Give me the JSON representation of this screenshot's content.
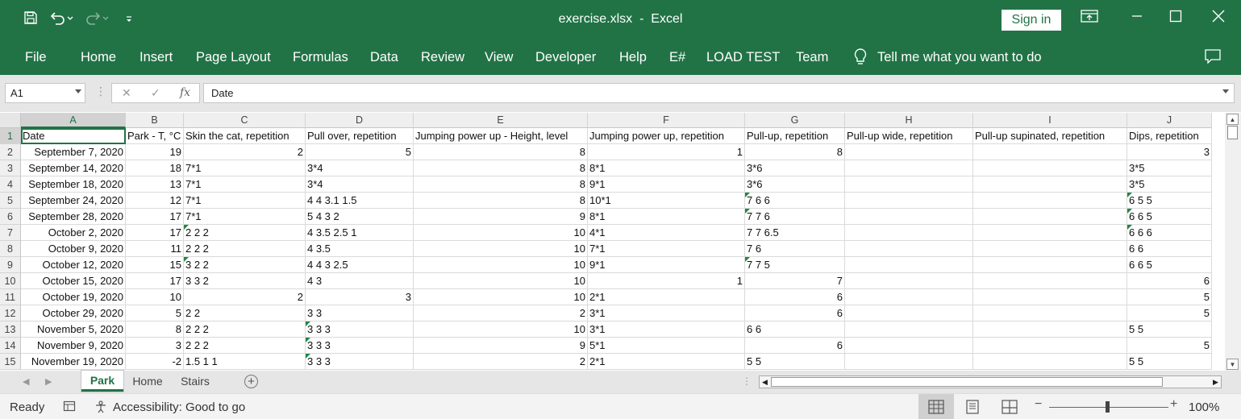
{
  "window": {
    "title": "exercise.xlsx  -  Excel",
    "sign_in": "Sign in"
  },
  "ribbon": {
    "tabs": [
      "File",
      "Home",
      "Insert",
      "Page Layout",
      "Formulas",
      "Data",
      "Review",
      "View",
      "Developer",
      "Help",
      "E#",
      "LOAD TEST",
      "Team"
    ],
    "tell_me": "Tell me what you want to do"
  },
  "formula_bar": {
    "name_box": "A1",
    "formula": "Date"
  },
  "grid": {
    "columns": [
      "A",
      "B",
      "C",
      "D",
      "E",
      "F",
      "G",
      "H",
      "I",
      "J"
    ],
    "selected_column": "A",
    "selected_row": "1",
    "row_numbers": [
      "1",
      "2",
      "3",
      "4",
      "5",
      "6",
      "7",
      "8",
      "9",
      "10",
      "11",
      "12",
      "13",
      "14",
      "15"
    ],
    "rows": [
      [
        "Date",
        "Park - T, °C",
        "Skin the cat, repetition",
        "Pull over, repetition",
        "Jumping power up - Height, level",
        "Jumping power up, repetition",
        "Pull-up, repetition",
        "Pull-up wide, repetition",
        "Pull-up supinated, repetition",
        "Dips, repetition"
      ],
      [
        "September 7, 2020",
        "19",
        "2",
        "5",
        "8",
        "1",
        "8",
        "",
        "",
        "3"
      ],
      [
        "September 14, 2020",
        "18",
        "7*1",
        "3*4",
        "8",
        "8*1",
        "3*6",
        "",
        "",
        "3*5"
      ],
      [
        "September 18, 2020",
        "13",
        "7*1",
        "3*4",
        "8",
        "9*1",
        "3*6",
        "",
        "",
        "3*5"
      ],
      [
        "September 24, 2020",
        "12",
        "7*1",
        "4 4 3.1 1.5",
        "8",
        "10*1",
        "7 6 6",
        "",
        "",
        "6 5 5"
      ],
      [
        "September 28, 2020",
        "17",
        "7*1",
        "5 4 3 2",
        "9",
        "8*1",
        "7 7 6",
        "",
        "",
        "6 6 5"
      ],
      [
        "October 2, 2020",
        "17",
        "2 2 2",
        "4 3.5 2.5 1",
        "10",
        "4*1",
        "7 7 6.5",
        "",
        "",
        "6 6 6"
      ],
      [
        "October 9, 2020",
        "11",
        "2 2 2",
        "4 3.5",
        "10",
        "7*1",
        "7 6",
        "",
        "",
        "6 6"
      ],
      [
        "October 12, 2020",
        "15",
        "3 2 2",
        "4 4 3 2.5",
        "10",
        "9*1",
        "7 7 5",
        "",
        "",
        "6 6 5"
      ],
      [
        "October 15, 2020",
        "17",
        "3 3 2",
        "4 3",
        "10",
        "1",
        "7",
        "",
        "",
        "6"
      ],
      [
        "October 19, 2020",
        "10",
        "2",
        "3",
        "10",
        "2*1",
        "6",
        "",
        "",
        "5"
      ],
      [
        "October 29, 2020",
        "5",
        "2 2",
        "3 3",
        "2",
        "3*1",
        "6",
        "",
        "",
        "5"
      ],
      [
        "November 5, 2020",
        "8",
        "2 2 2",
        "3 3 3",
        "10",
        "3*1",
        "6 6",
        "",
        "",
        "5 5"
      ],
      [
        "November 9, 2020",
        "3",
        "2 2 2",
        "3 3 3",
        "9",
        "5*1",
        "6",
        "",
        "",
        "5"
      ],
      [
        "November 19, 2020",
        "-2",
        "1.5 1 1",
        "3 3 3",
        "2",
        "2*1",
        "5 5",
        "",
        "",
        "5 5"
      ]
    ]
  },
  "sheets": {
    "tabs": [
      "Park",
      "Home",
      "Stairs"
    ],
    "active": "Park"
  },
  "status": {
    "ready": "Ready",
    "accessibility": "Accessibility: Good to go",
    "zoom": "100%",
    "zoom_level_percent": 100
  }
}
